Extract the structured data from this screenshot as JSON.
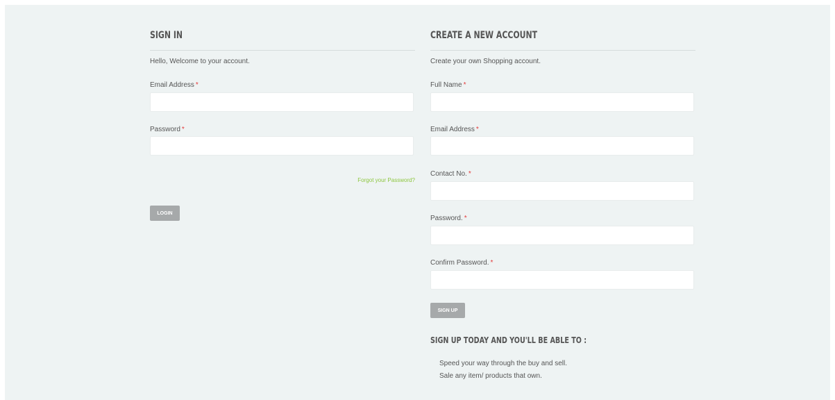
{
  "signin": {
    "heading": "SIGN IN",
    "intro": "Hello, Welcome to your account.",
    "email_label": "Email Address",
    "password_label": "Password",
    "required_mark": "*",
    "email_value": "",
    "password_value": "",
    "forgot_link": "Forgot your Password?",
    "login_button": "LOGIN"
  },
  "register": {
    "heading": "CREATE A NEW ACCOUNT",
    "intro": "Create your own Shopping account.",
    "fields": [
      {
        "label": "Full Name",
        "value": ""
      },
      {
        "label": "Email Address",
        "value": ""
      },
      {
        "label": "Contact No.",
        "value": ""
      },
      {
        "label": "Password.",
        "value": ""
      },
      {
        "label": "Confirm Password.",
        "value": ""
      }
    ],
    "required_mark": "*",
    "signup_button": "SIGN UP",
    "benefits_heading": "SIGN UP TODAY AND YOU'LL BE ABLE TO :",
    "benefits": [
      "Speed your way through the buy and sell.",
      "Sale any item/ products that own."
    ]
  },
  "colors": {
    "background": "#eef3f3",
    "link": "#8dc63f",
    "required": "#e33b3b",
    "button": "#a6a9aa"
  }
}
